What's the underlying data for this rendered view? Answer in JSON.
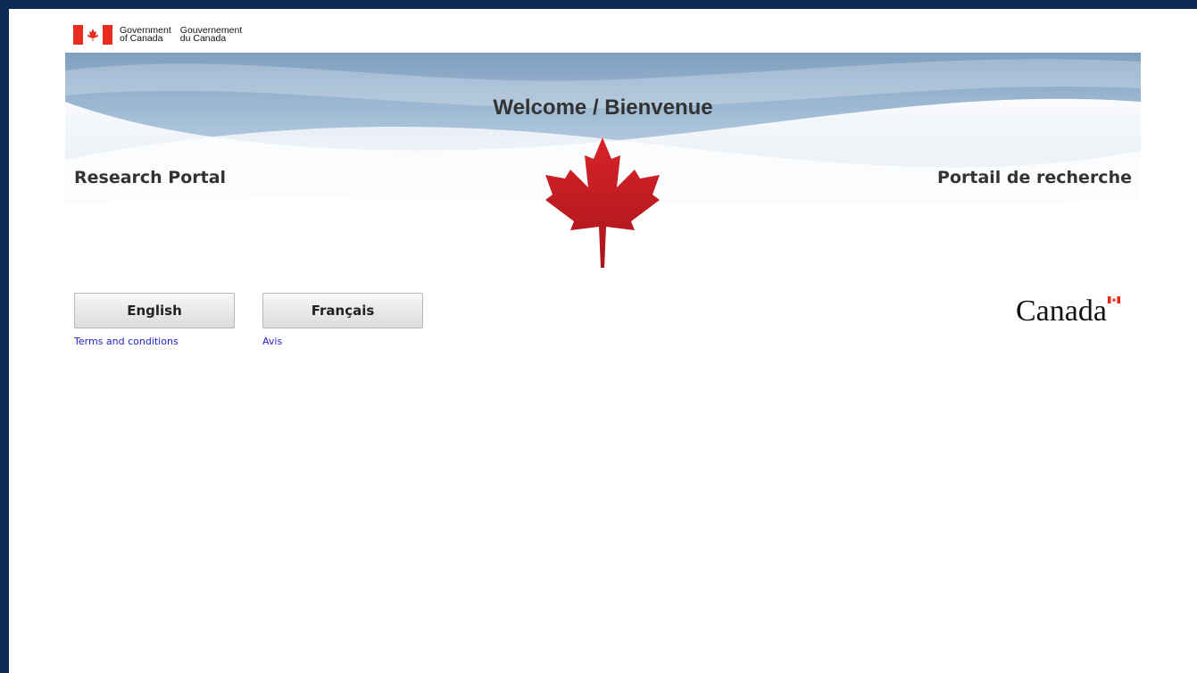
{
  "header": {
    "gov_en_line1": "Government",
    "gov_en_line2": "of Canada",
    "gov_fr_line1": "Gouvernement",
    "gov_fr_line2": "du Canada",
    "flag_icon": "canada-flag-icon"
  },
  "banner": {
    "title": "Welcome / Bienvenue",
    "left_label": "Research Portal",
    "right_label": "Portail de recherche",
    "emblem": "maple-leaf-icon"
  },
  "language": {
    "english_button": "English",
    "french_button": "Français",
    "english_terms_link": "Terms and conditions",
    "french_terms_link": "Avis"
  },
  "footer": {
    "wordmark": "Canada",
    "wordmark_flag_icon": "canada-wordmark-flag-icon"
  },
  "colors": {
    "frame": "#0b2a55",
    "flag_red": "#ea2b1f",
    "maple_red": "#c0171b",
    "link": "#2222cc"
  }
}
